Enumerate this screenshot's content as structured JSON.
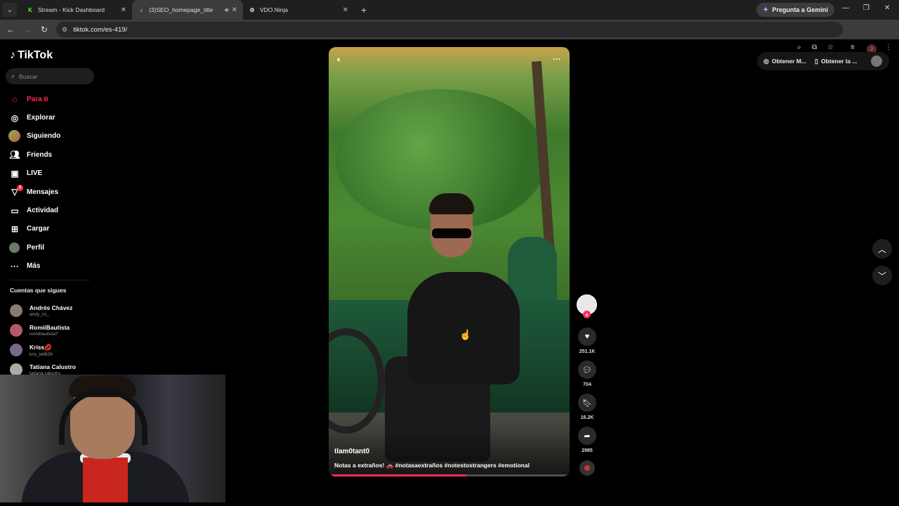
{
  "browser": {
    "tabs": [
      {
        "title": "Stream - Kick Dashboard",
        "favicon": "K",
        "color": "#53fc18"
      },
      {
        "title": "(3)SEO_homepage_title",
        "favicon": "♪",
        "color": "#ffffff"
      },
      {
        "title": "VDO.Ninja",
        "favicon": "⚙",
        "color": "#ffffff"
      }
    ],
    "new_tab": "+",
    "gemini_label": "Pregunta a Gemini",
    "url": "tiktok.com/es-419/",
    "profile_initial": "J"
  },
  "tiktok": {
    "logo": "TikTok",
    "search_placeholder": "Buscar",
    "nav": [
      {
        "label": "Para ti",
        "icon": "home-icon",
        "active": true
      },
      {
        "label": "Explorar",
        "icon": "compass-icon"
      },
      {
        "label": "Siguiendo",
        "icon": "avatar"
      },
      {
        "label": "Friends",
        "icon": "friends-icon"
      },
      {
        "label": "LIVE",
        "icon": "live-icon"
      },
      {
        "label": "Mensajes",
        "icon": "send-icon",
        "badge": "3"
      },
      {
        "label": "Actividad",
        "icon": "activity-icon"
      },
      {
        "label": "Cargar",
        "icon": "upload-icon"
      },
      {
        "label": "Perfil",
        "icon": "avatar"
      },
      {
        "label": "Más",
        "icon": "more-icon"
      }
    ],
    "following_title": "Cuentas que sigues",
    "accounts": [
      {
        "name": "Andrés Chávez",
        "username": "andy_cs_"
      },
      {
        "name": "RomiiBautista",
        "username": "romiibautista7"
      },
      {
        "name": "Kriss💋",
        "username": "kris_tell826"
      },
      {
        "name": "Tatiana Calustro",
        "username": "tatiana.calustro"
      }
    ],
    "video": {
      "author": "tlam0tant0",
      "caption": "Notas a extraños! 🚗 #notasaextraños #notestostrangers #emotional",
      "progress_fraction": 0.57
    },
    "actions": {
      "likes": "251.1K",
      "comments": "704",
      "saves": "16.2K",
      "shares": "2985"
    },
    "top_right": {
      "get_app1": "Obtener M...",
      "get_app2": "Obtener la ..."
    }
  }
}
